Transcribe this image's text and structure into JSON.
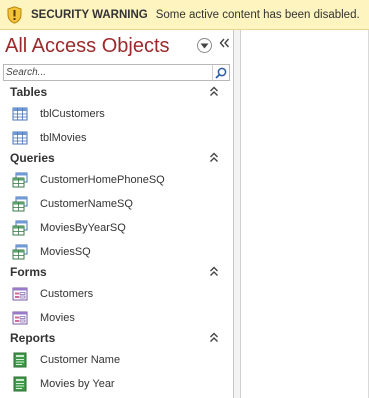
{
  "message_bar": {
    "title": "SECURITY WARNING",
    "text": "Some active content has been disabled."
  },
  "nav_pane": {
    "title": "All Access Objects",
    "search": {
      "placeholder": "Search..."
    },
    "groups": [
      {
        "label": "Tables",
        "items": [
          {
            "label": "tblCustomers",
            "icon": "table-icon"
          },
          {
            "label": "tblMovies",
            "icon": "table-icon"
          }
        ]
      },
      {
        "label": "Queries",
        "items": [
          {
            "label": "CustomerHomePhoneSQ",
            "icon": "query-icon"
          },
          {
            "label": "CustomerNameSQ",
            "icon": "query-icon"
          },
          {
            "label": "MoviesByYearSQ",
            "icon": "query-icon"
          },
          {
            "label": "MoviesSQ",
            "icon": "query-icon"
          }
        ]
      },
      {
        "label": "Forms",
        "items": [
          {
            "label": "Customers",
            "icon": "form-icon"
          },
          {
            "label": "Movies",
            "icon": "form-icon"
          }
        ]
      },
      {
        "label": "Reports",
        "items": [
          {
            "label": "Customer Name",
            "icon": "report-icon"
          },
          {
            "label": "Movies by Year",
            "icon": "report-icon"
          }
        ]
      }
    ]
  },
  "colors": {
    "message_bar_bg": "#fdf4bf",
    "nav_title": "#9c2a2a"
  }
}
